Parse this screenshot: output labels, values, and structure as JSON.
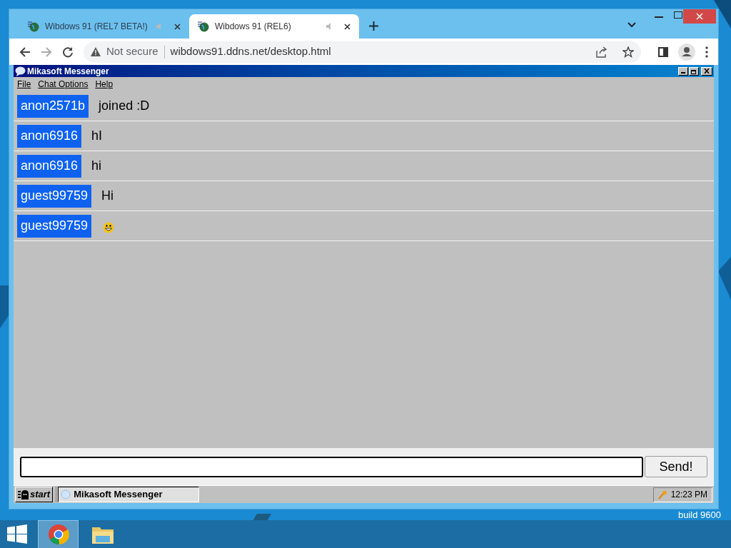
{
  "browser": {
    "tabs": [
      {
        "title": "Wibdows 91 (REL7 BETA!)",
        "selected": false
      },
      {
        "title": "Wibdows 91 (REL6)",
        "selected": true
      }
    ],
    "address": {
      "security": "Not secure",
      "url": "wibdows91.ddns.net/desktop.html"
    }
  },
  "app_window": {
    "title": "Mikasoft Messenger",
    "menu": [
      "File",
      "Chat Options",
      "Help"
    ],
    "messages": [
      {
        "user": "anon2571b",
        "kind": "text",
        "text": "joined :D"
      },
      {
        "user": "anon6916",
        "kind": "text",
        "text": "hI"
      },
      {
        "user": "anon6916",
        "kind": "text",
        "text": "hi"
      },
      {
        "user": "guest99759",
        "kind": "text",
        "text": "Hi"
      },
      {
        "user": "guest99759",
        "kind": "emoji"
      }
    ],
    "send_button": "Send!"
  },
  "inner_taskbar": {
    "start": "start",
    "tasks": [
      "Mikasoft Messenger"
    ],
    "clock": "12:23 PM"
  },
  "desktop": {
    "watermark_text": "build 9600"
  }
}
